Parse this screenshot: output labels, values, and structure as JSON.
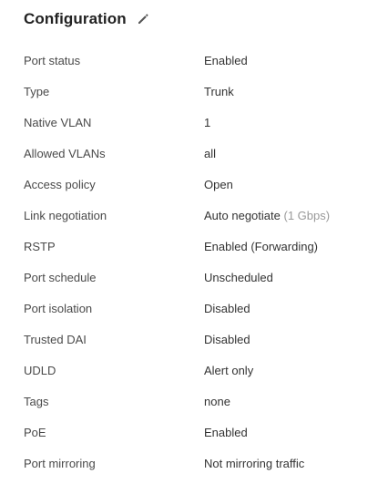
{
  "header": {
    "title": "Configuration",
    "edit_icon": "pencil-icon"
  },
  "rows": [
    {
      "label": "Port status",
      "value": "Enabled"
    },
    {
      "label": "Type",
      "value": "Trunk"
    },
    {
      "label": "Native VLAN",
      "value": "1"
    },
    {
      "label": "Allowed VLANs",
      "value": "all"
    },
    {
      "label": "Access policy",
      "value": "Open"
    },
    {
      "label": "Link negotiation",
      "value": "Auto negotiate",
      "note": "(1 Gbps)"
    },
    {
      "label": "RSTP",
      "value": "Enabled (Forwarding)"
    },
    {
      "label": "Port schedule",
      "value": "Unscheduled"
    },
    {
      "label": "Port isolation",
      "value": "Disabled"
    },
    {
      "label": "Trusted DAI",
      "value": "Disabled"
    },
    {
      "label": "UDLD",
      "value": "Alert only"
    },
    {
      "label": "Tags",
      "value": "none"
    },
    {
      "label": "PoE",
      "value": "Enabled"
    },
    {
      "label": "Port mirroring",
      "value": "Not mirroring traffic"
    }
  ],
  "colors": {
    "muted_text": "#9a9a9a",
    "label_text": "#4a4a4a"
  }
}
